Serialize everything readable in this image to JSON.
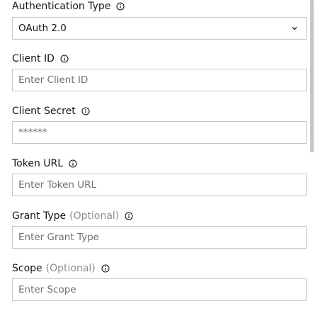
{
  "auth_type": {
    "label": "Authentication Type",
    "selected": "OAuth 2.0"
  },
  "client_id": {
    "label": "Client ID",
    "placeholder": "Enter Client ID"
  },
  "client_secret": {
    "label": "Client Secret",
    "value": "******"
  },
  "token_url": {
    "label": "Token URL",
    "placeholder": "Enter Token URL"
  },
  "grant_type": {
    "label": "Grant Type",
    "optional": "(Optional)",
    "placeholder": "Enter Grant Type"
  },
  "scope": {
    "label": "Scope",
    "optional": "(Optional)",
    "placeholder": "Enter Scope"
  },
  "icons": {
    "info": "info-circle-icon",
    "dropdown": "chevron-down-icon"
  },
  "colors": {
    "border": "#c6c6c6",
    "label": "#161616",
    "optional": "#8d8d8d",
    "placeholder": "#6f6f6f"
  }
}
